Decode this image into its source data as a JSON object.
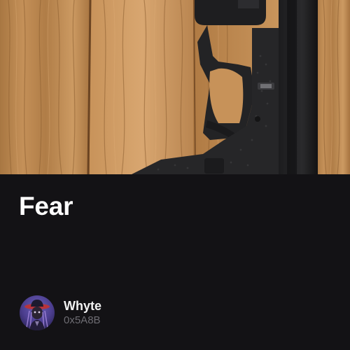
{
  "post": {
    "title": "Fear",
    "image_description_icon": "pistol-on-wood-photo"
  },
  "creator": {
    "name": "Whyte",
    "address": "0x5A8B",
    "avatar_icon": "creator-avatar"
  },
  "colors": {
    "background": "#131215",
    "title_text": "#ffffff",
    "name_text": "#f2f2f2",
    "address_text": "#6d6c72",
    "wood": "#b8864d"
  }
}
